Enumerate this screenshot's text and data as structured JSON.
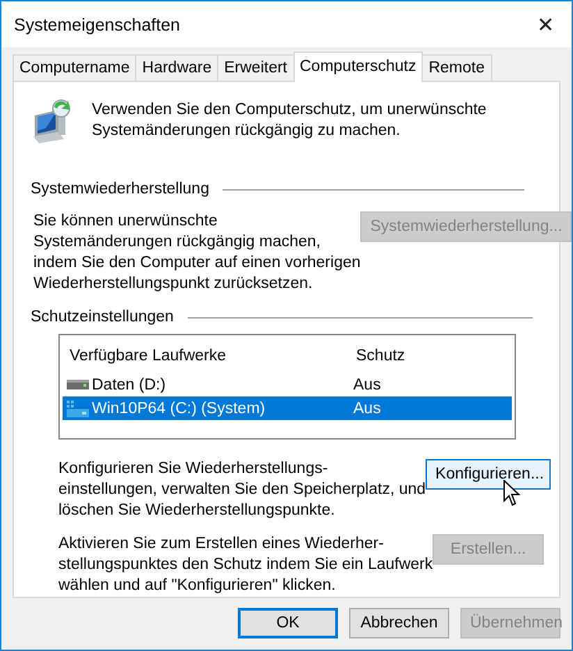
{
  "window": {
    "title": "Systemeigenschaften",
    "close": "✕"
  },
  "tabs": [
    {
      "label": "Computername",
      "selected": false
    },
    {
      "label": "Hardware",
      "selected": false
    },
    {
      "label": "Erweitert",
      "selected": false
    },
    {
      "label": "Computerschutz",
      "selected": true
    },
    {
      "label": "Remote",
      "selected": false
    }
  ],
  "intro": "Verwenden Sie den Computerschutz, um unerwünschte\nSystemänderungen rückgängig zu machen.",
  "system_restore": {
    "heading": "Systemwiederherstellung",
    "text": "Sie können unerwünschte\nSystemänderungen rückgängig machen,\nindem Sie den Computer auf einen vorherigen\nWiederherstellungspunkt zurücksetzen.",
    "button": {
      "label": "Systemwiederherstellung...",
      "disabled": true,
      "hovered": false
    }
  },
  "protection": {
    "heading": "Schutzeinstellungen",
    "columns": [
      "Verfügbare Laufwerke",
      "Schutz"
    ],
    "rows": [
      {
        "kind": "data",
        "drive": "Daten (D:)",
        "protection": "Aus",
        "selected": false
      },
      {
        "kind": "system",
        "drive": "Win10P64 (C:) (System)",
        "protection": "Aus",
        "selected": true
      }
    ],
    "configure": {
      "text": "Konfigurieren Sie Wiederherstellungs-\neinstellungen, verwalten Sie den Speicherplatz, und\nlöschen Sie Wiederherstellungspunkte.",
      "button": {
        "label": "Konfigurieren...",
        "disabled": false,
        "hovered": true
      }
    },
    "create": {
      "text": "Aktivieren Sie zum Erstellen eines Wiederher-\nstellungspunktes den Schutz indem Sie ein Laufwerk\nwählen und auf \"Konfigurieren\" klicken.",
      "button": {
        "label": "Erstellen...",
        "disabled": true,
        "hovered": false
      }
    }
  },
  "buttons": [
    {
      "label": "OK",
      "disabled": false,
      "default": true
    },
    {
      "label": "Abbrechen",
      "disabled": false,
      "default": false
    },
    {
      "label": "Übernehmen",
      "disabled": true,
      "default": false
    }
  ]
}
